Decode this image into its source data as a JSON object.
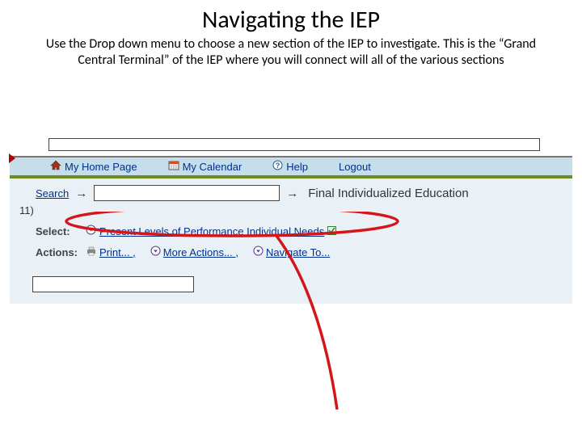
{
  "title": "Navigating the IEP",
  "subtitle": "Use the Drop down menu to choose a new section of the IEP to investigate. This is the “Grand Central Terminal” of the IEP where you will connect will all of the various sections",
  "nav": {
    "home": "My Home Page",
    "calendar": "My Calendar",
    "help": "Help",
    "logout": "Logout"
  },
  "body": {
    "search_label": "Search",
    "final_label": "Final Individualized Education",
    "eleven": "11)",
    "select_label": "Select:",
    "select_value": "Present Levels of Performance Individual Needs",
    "actions_label": "Actions:",
    "print": "Print... ,",
    "more": "More Actions... ,",
    "nav_to": "Navigate To..."
  }
}
